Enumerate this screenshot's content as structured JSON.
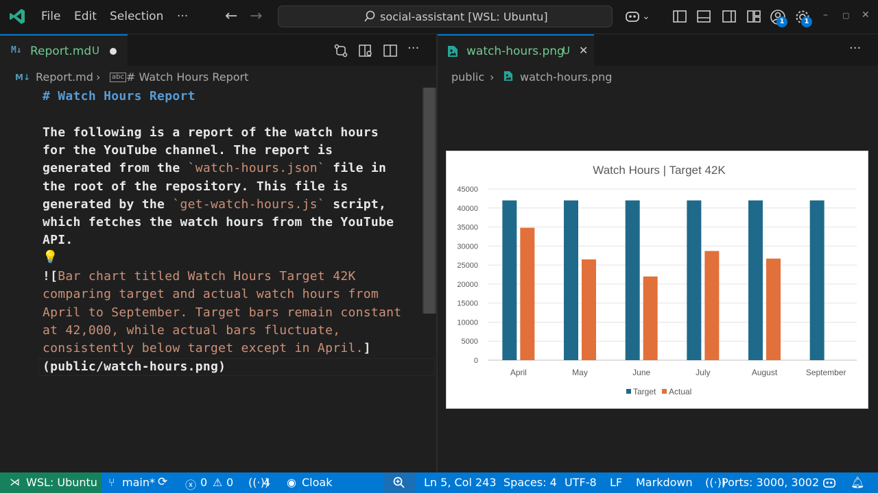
{
  "titlebar": {
    "menus": [
      "File",
      "Edit",
      "Selection",
      "···"
    ],
    "command_center": "social-assistant [WSL: Ubuntu]",
    "account_badge": "1",
    "settings_badge": "1"
  },
  "left_editor": {
    "tab": {
      "name": "Report.md",
      "status": "U",
      "icon": "M↓"
    },
    "breadcrumb": {
      "file": "Report.md",
      "section": "# Watch Hours Report"
    },
    "lines": [
      {
        "kind": "h1",
        "text": "# Watch Hours Report"
      },
      {
        "kind": "blank",
        "text": ""
      },
      {
        "kind": "plain",
        "text": "The following is a report of the watch hours"
      },
      {
        "kind": "plain",
        "text": "for the YouTube channel. The report is"
      },
      {
        "kind": "mixed",
        "parts": [
          {
            "t": "generated from the ",
            "c": "plain"
          },
          {
            "t": "`watch-hours.json`",
            "c": "str"
          },
          {
            "t": " file in",
            "c": "plain"
          }
        ]
      },
      {
        "kind": "plain",
        "text": "the root of the repository. This file is"
      },
      {
        "kind": "mixed",
        "parts": [
          {
            "t": "generated by the ",
            "c": "plain"
          },
          {
            "t": "`get-watch-hours.js`",
            "c": "str"
          },
          {
            "t": " script,",
            "c": "plain"
          }
        ]
      },
      {
        "kind": "plain",
        "text": "which fetches the watch hours from the YouTube"
      },
      {
        "kind": "plain",
        "text": "API."
      },
      {
        "kind": "blank",
        "text": ""
      },
      {
        "kind": "mixed",
        "parts": [
          {
            "t": "![",
            "c": "plain"
          },
          {
            "t": "Bar chart titled Watch Hours Target 42K",
            "c": "alt"
          }
        ]
      },
      {
        "kind": "alt",
        "text": "comparing target and actual watch hours from"
      },
      {
        "kind": "alt",
        "text": "April to September. Target bars remain constant"
      },
      {
        "kind": "alt",
        "text": "at 42,000, while actual bars fluctuate,"
      },
      {
        "kind": "mixed",
        "parts": [
          {
            "t": "consistently below target except in April.",
            "c": "alt"
          },
          {
            "t": "]",
            "c": "plain"
          }
        ]
      },
      {
        "kind": "plain",
        "text": "(public/watch-hours.png)"
      }
    ]
  },
  "right_editor": {
    "tab": {
      "name": "watch-hours.png",
      "status": "U"
    },
    "breadcrumb": {
      "folder": "public",
      "file": "watch-hours.png"
    }
  },
  "chart_data": {
    "type": "bar",
    "title": "Watch Hours | Target 42K",
    "categories": [
      "April",
      "May",
      "June",
      "July",
      "August",
      "September"
    ],
    "series": [
      {
        "name": "Target",
        "color": "#1f6a8a",
        "values": [
          42000,
          42000,
          42000,
          42000,
          42000,
          42000
        ]
      },
      {
        "name": "Actual",
        "color": "#e2703a",
        "values": [
          34800,
          26500,
          22000,
          28700,
          26700,
          null
        ]
      }
    ],
    "ylim": [
      0,
      45000
    ],
    "yticks": [
      0,
      5000,
      10000,
      15000,
      20000,
      25000,
      30000,
      35000,
      40000,
      45000
    ],
    "grid": true,
    "legend": "bottom"
  },
  "statusbar": {
    "remote": "WSL: Ubuntu",
    "branch": "main*",
    "errors": "0",
    "warnings": "0",
    "ports_count": "4",
    "cloak": "Cloak",
    "position": "Ln 5, Col 243",
    "spaces": "Spaces: 4",
    "encoding": "UTF-8",
    "eol": "LF",
    "language": "Markdown",
    "ports": "Ports: 3000, 3002"
  }
}
